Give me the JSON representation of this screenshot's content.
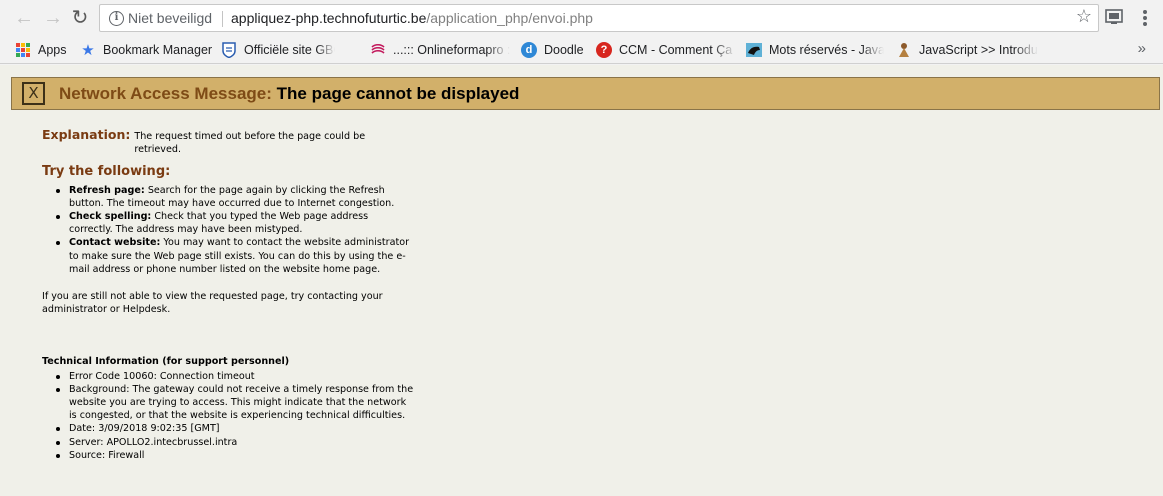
{
  "browser": {
    "security_label": "Niet beveiligd",
    "url_host": "appliquez-php.technofuturtic.be",
    "url_path": "/application_php/envoi.php"
  },
  "bookmarks": [
    {
      "label": "Apps",
      "icon": "apps-grid-icon"
    },
    {
      "label": "Bookmark Manager",
      "icon": "star-icon"
    },
    {
      "label": "Officiële site GBOU S",
      "icon": "shield-icon"
    },
    {
      "label": "...::: Onlineformapro ::",
      "icon": "swirl-icon"
    },
    {
      "label": "Doodle",
      "icon": "doodle-icon"
    },
    {
      "label": "CCM - Comment Ça M",
      "icon": "ccm-icon"
    },
    {
      "label": "Mots réservés - JavaS",
      "icon": "panther-icon"
    },
    {
      "label": "JavaScript >> Introdu",
      "icon": "person-icon"
    }
  ],
  "banner": {
    "close_glyph": "X",
    "label": "Network Access Message:",
    "title": "The page cannot be displayed"
  },
  "explanation": {
    "heading": "Explanation:",
    "text": "The request timed out before the page could be retrieved."
  },
  "try": {
    "heading": "Try the following:",
    "items": [
      {
        "bold": "Refresh page:",
        "text": "Search for the page again by clicking the Refresh button. The timeout may have occurred due to Internet congestion."
      },
      {
        "bold": "Check spelling:",
        "text": "Check that you typed the Web page address correctly. The address may have been mistyped."
      },
      {
        "bold": "Contact website:",
        "text": "You may want to contact the website administrator to make sure the Web page still exists. You can do this by using the e-mail address or phone number listed on the website home page."
      }
    ]
  },
  "still_text": "If you are still not able to view the requested page, try contacting your administrator or Helpdesk.",
  "technical": {
    "heading": "Technical Information (for support personnel)",
    "items": [
      "Error Code 10060: Connection timeout",
      "Background: The gateway could not receive a timely response from the website you are trying to access. This might indicate that the network is congested, or that the website is experiencing technical difficulties.",
      "Date: 3/09/2018 9:02:35 [GMT]",
      "Server: APOLLO2.intecbrussel.intra",
      "Source: Firewall"
    ]
  }
}
